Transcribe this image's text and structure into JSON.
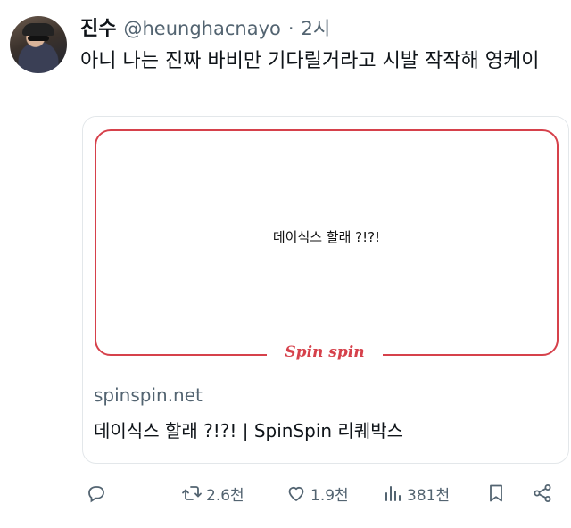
{
  "tweet": {
    "display_name": "진수",
    "handle": "@heunghacnayo",
    "separator": "·",
    "time": "2시",
    "text": "아니 나는 진짜 바비만 기다릴거라고 시발 작작해 영케이"
  },
  "card": {
    "image_text": "데이식스 할래 ?!?!",
    "logo_text": "Spin spin",
    "domain": "spinspin.net",
    "title": "데이식스 할래 ?!?! | SpinSpin 리퀘박스"
  },
  "actions": {
    "reply": {
      "icon": "reply-icon",
      "count": ""
    },
    "retweet": {
      "icon": "retweet-icon",
      "count": "2.6천"
    },
    "like": {
      "icon": "heart-icon",
      "count": "1.9천"
    },
    "views": {
      "icon": "views-icon",
      "count": "381천"
    },
    "bookmark": {
      "icon": "bookmark-icon"
    },
    "share": {
      "icon": "share-icon"
    }
  },
  "colors": {
    "text": "#0f1419",
    "secondary": "#536471",
    "card_border": "#e3e7ea",
    "brand_red": "#d6414b"
  }
}
